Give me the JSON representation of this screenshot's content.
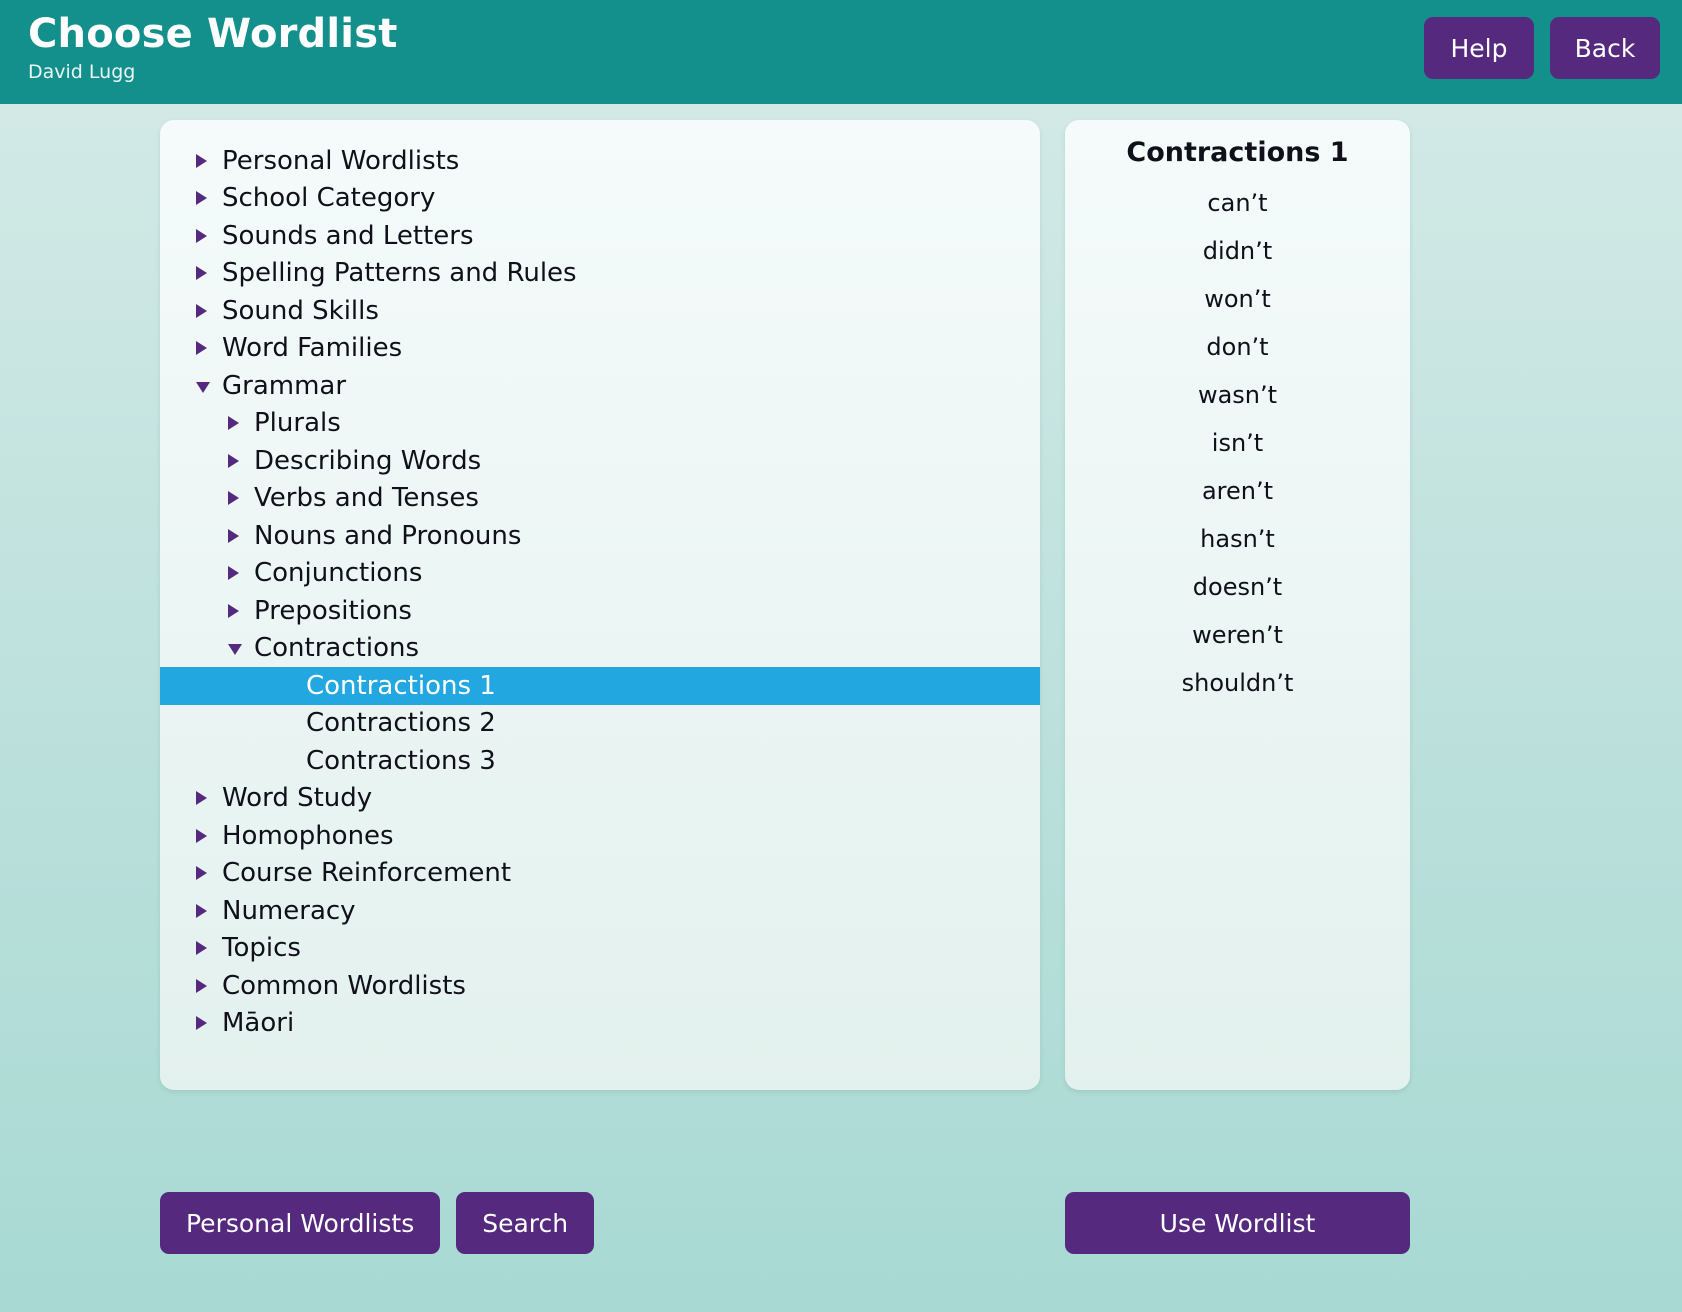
{
  "header": {
    "title": "Choose Wordlist",
    "user": "David Lugg",
    "help_label": "Help",
    "back_label": "Back",
    "bg_color": "#13908c",
    "button_color": "#552a7e"
  },
  "tree": {
    "selected_id": "contractions-1",
    "selection_color": "#22a7e0",
    "marker_color": "#552a7e",
    "items": [
      {
        "label": "Personal Wordlists",
        "level": 0,
        "state": "closed"
      },
      {
        "label": "School Category",
        "level": 0,
        "state": "closed"
      },
      {
        "label": "Sounds and Letters",
        "level": 0,
        "state": "closed"
      },
      {
        "label": "Spelling Patterns and Rules",
        "level": 0,
        "state": "closed"
      },
      {
        "label": "Sound Skills",
        "level": 0,
        "state": "closed"
      },
      {
        "label": "Word Families",
        "level": 0,
        "state": "closed"
      },
      {
        "label": "Grammar",
        "level": 0,
        "state": "open"
      },
      {
        "label": "Plurals",
        "level": 1,
        "state": "closed"
      },
      {
        "label": "Describing Words",
        "level": 1,
        "state": "closed"
      },
      {
        "label": "Verbs and Tenses",
        "level": 1,
        "state": "closed"
      },
      {
        "label": "Nouns and Pronouns",
        "level": 1,
        "state": "closed"
      },
      {
        "label": "Conjunctions",
        "level": 1,
        "state": "closed"
      },
      {
        "label": "Prepositions",
        "level": 1,
        "state": "closed"
      },
      {
        "label": "Contractions",
        "level": 1,
        "state": "open"
      },
      {
        "label": "Contractions 1",
        "level": 2,
        "state": "leaf",
        "selected": true
      },
      {
        "label": "Contractions 2",
        "level": 2,
        "state": "leaf"
      },
      {
        "label": "Contractions 3",
        "level": 2,
        "state": "leaf"
      },
      {
        "label": "Word Study",
        "level": 0,
        "state": "closed"
      },
      {
        "label": "Homophones",
        "level": 0,
        "state": "closed"
      },
      {
        "label": "Course Reinforcement",
        "level": 0,
        "state": "closed"
      },
      {
        "label": "Numeracy",
        "level": 0,
        "state": "closed"
      },
      {
        "label": "Topics",
        "level": 0,
        "state": "closed"
      },
      {
        "label": "Common Wordlists",
        "level": 0,
        "state": "closed"
      },
      {
        "label": "Māori",
        "level": 0,
        "state": "closed"
      }
    ]
  },
  "wordlist": {
    "title": "Contractions 1",
    "words": [
      "can’t",
      "didn’t",
      "won’t",
      "don’t",
      "wasn’t",
      "isn’t",
      "aren’t",
      "hasn’t",
      "doesn’t",
      "weren’t",
      "shouldn’t"
    ]
  },
  "footer": {
    "personal_wordlists_label": "Personal Wordlists",
    "search_label": "Search",
    "use_wordlist_label": "Use Wordlist"
  }
}
